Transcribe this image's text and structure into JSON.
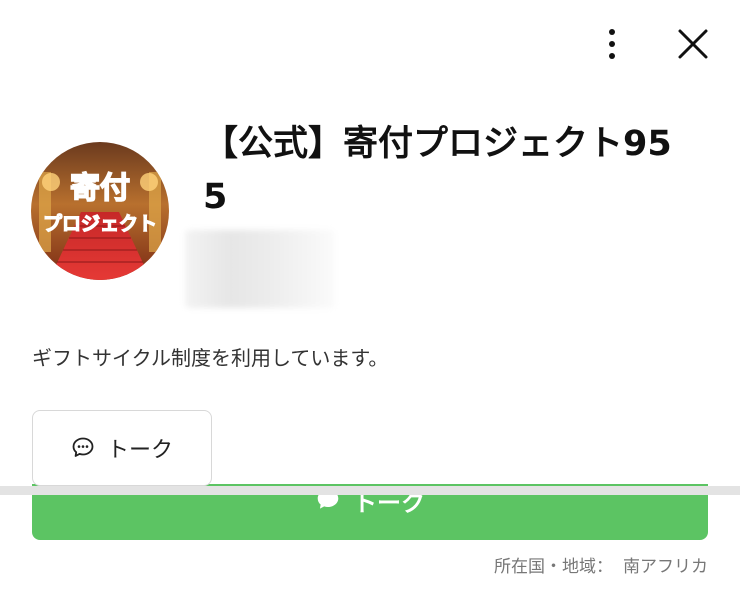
{
  "header": {
    "more_icon": "vertical-ellipsis-icon",
    "close_icon": "close-icon"
  },
  "profile": {
    "name": "【公式】寄付プロジェクト955",
    "avatar": {
      "text_top": "寄付",
      "text_bottom": "プロジェクト"
    },
    "status_message": "ギフトサイクル制度を利用しています。"
  },
  "actions": {
    "talk_small_label": "トーク",
    "talk_large_label": "トーク",
    "talk_icon": "chat-bubble-icon",
    "accent_color": "#5cc463"
  },
  "footer": {
    "location_label": "所在国・地域：",
    "location_value": "南アフリカ"
  }
}
